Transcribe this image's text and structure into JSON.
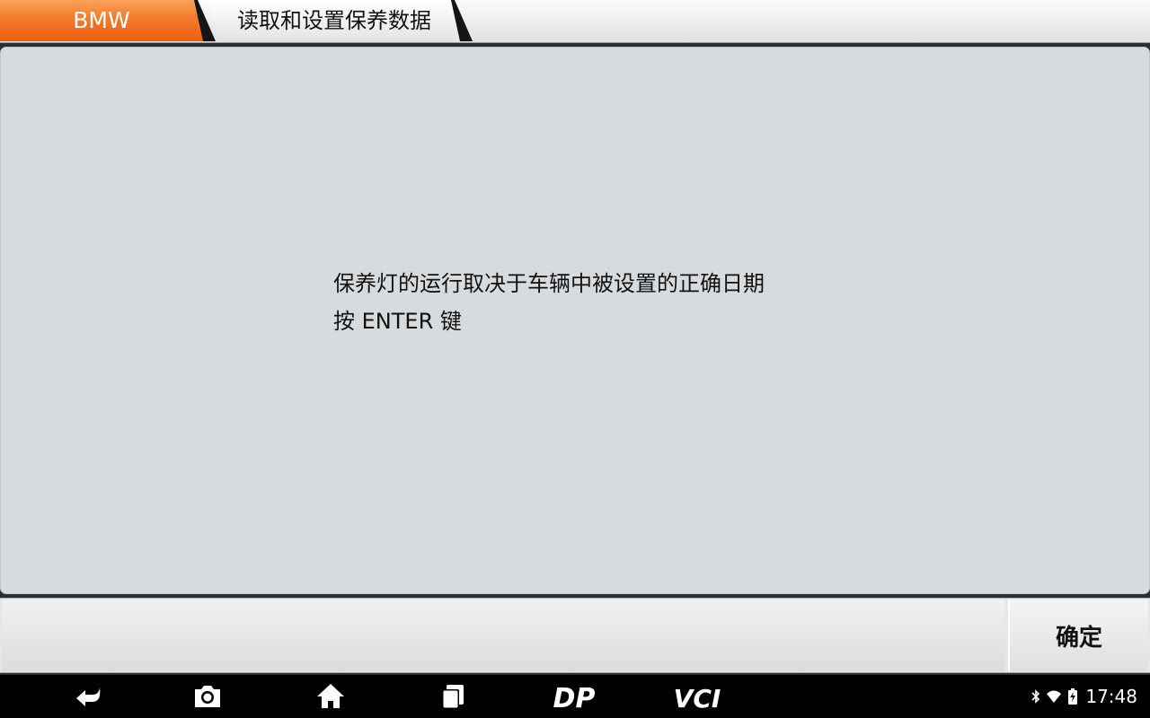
{
  "breadcrumb": {
    "brand": "BMW",
    "page": "读取和设置保养数据"
  },
  "message": {
    "line1": "保养灯的运行取决于车辆中被设置的正确日期",
    "line2": "按 ENTER 键"
  },
  "footer": {
    "confirm_label": "确定"
  },
  "navbar": {
    "buttons": [
      "back-icon",
      "camera-icon",
      "home-icon",
      "recent-apps-icon",
      "dp-logo",
      "vci-logo"
    ],
    "dp_text": "DP",
    "vci_text": "VCI"
  },
  "status": {
    "time": "17:48",
    "icons": [
      "bluetooth-icon",
      "wifi-icon",
      "battery-charging-icon"
    ]
  },
  "colors": {
    "brand_tab": "#f26c1f",
    "panel": "#d8dbde",
    "navbar": "#000000"
  }
}
